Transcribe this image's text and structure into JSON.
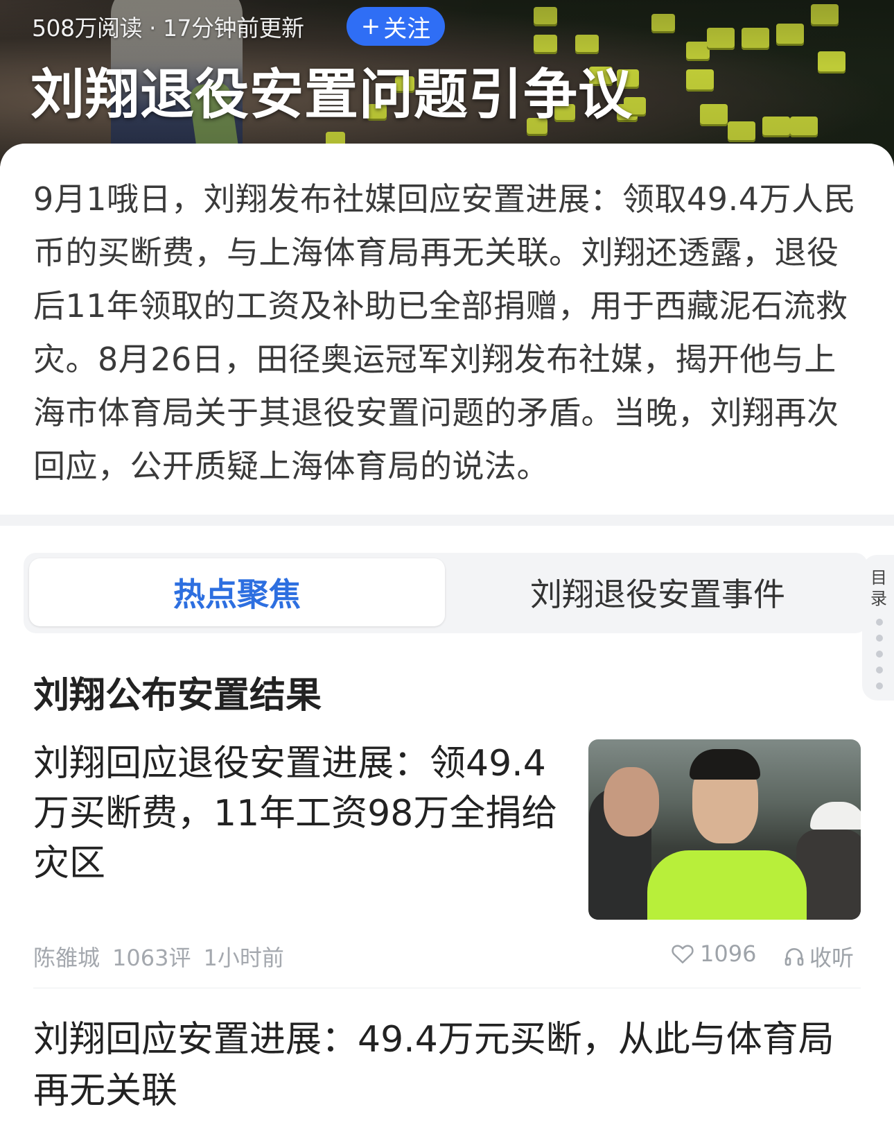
{
  "header": {
    "read_count": "508万阅读",
    "separator": "·",
    "updated": "17分钟前更新",
    "follow_label": "关注",
    "follow_prefix": "+",
    "title": "刘翔退役安置问题引争议"
  },
  "summary": {
    "text": "9月1哦日，刘翔发布社媒回应安置进展：领取49.4万人民币的买断费，与上海体育局再无关联。刘翔还透露，退役后11年领取的工资及补助已全部捐赠，用于西藏泥石流救灾。8月26日，田径奥运冠军刘翔发布社媒，揭开他与上海市体育局关于其退役安置问题的矛盾。当晚，刘翔再次回应，公开质疑上海体育局的说法。"
  },
  "tabs": [
    {
      "label": "热点聚焦",
      "active": true
    },
    {
      "label": "刘翔退役安置事件",
      "active": false
    }
  ],
  "toc": {
    "label": "目录"
  },
  "section": {
    "title": "刘翔公布安置结果"
  },
  "articles": [
    {
      "title": "刘翔回应退役安置进展：领49.4万买断费，11年工资98万全捐给灾区",
      "author": "陈雒城",
      "comments": "1063评",
      "time": "1小时前",
      "likes": "1096",
      "listen_label": "收听"
    },
    {
      "title": "刘翔回应安置进展：49.4万元买断，从此与体育局再无关联"
    }
  ],
  "colors": {
    "accent": "#2f6ef5",
    "tab_active": "#2d6fe0",
    "meta_gray": "#a4a8ae"
  }
}
